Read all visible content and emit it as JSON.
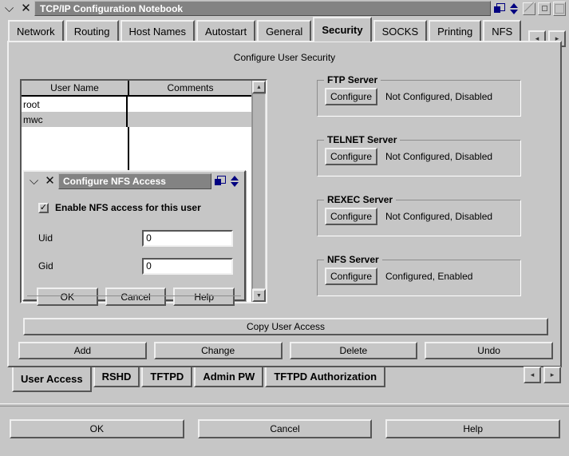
{
  "window": {
    "title": "TCP/IP Configuration Notebook",
    "minimize_icon": "minimize-icon",
    "close_icon": "close-icon",
    "restore_icon": "restore-windows-icon",
    "updown_icon": "up-down-arrows-icon",
    "maximize_icon": "maximize-icon",
    "small_icon": "small-window-icon",
    "frame_icon": "window-frame-icon"
  },
  "top_tabs": {
    "items": [
      {
        "label": "Network",
        "active": false
      },
      {
        "label": "Routing",
        "active": false
      },
      {
        "label": "Host Names",
        "active": false
      },
      {
        "label": "Autostart",
        "active": false
      },
      {
        "label": "General",
        "active": false
      },
      {
        "label": "Security",
        "active": true
      },
      {
        "label": "SOCKS",
        "active": false
      },
      {
        "label": "Printing",
        "active": false
      },
      {
        "label": "NFS",
        "active": false
      }
    ],
    "prev_arrow": "◂",
    "next_arrow": "▸"
  },
  "page": {
    "heading": "Configure User Security"
  },
  "user_list": {
    "columns": [
      "User Name",
      "Comments"
    ],
    "rows": [
      {
        "user_name": "root",
        "comments": "",
        "selected": false
      },
      {
        "user_name": "mwc",
        "comments": "",
        "selected": true
      }
    ],
    "scroll_up": "▲",
    "scroll_down": "▼"
  },
  "servers": [
    {
      "group": "FTP Server",
      "button": "Configure",
      "status": "Not Configured, Disabled"
    },
    {
      "group": "TELNET Server",
      "button": "Configure",
      "status": "Not Configured, Disabled"
    },
    {
      "group": "REXEC Server",
      "button": "Configure",
      "status": "Not Configured, Disabled"
    },
    {
      "group": "NFS Server",
      "button": "Configure",
      "status": "Configured, Enabled"
    }
  ],
  "actions": {
    "copy_user_access": "Copy User Access",
    "add": "Add",
    "change": "Change",
    "delete": "Delete",
    "undo": "Undo"
  },
  "bottom_tabs": {
    "items": [
      {
        "label": "User Access",
        "active": true
      },
      {
        "label": "RSHD",
        "active": false
      },
      {
        "label": "TFTPD",
        "active": false
      },
      {
        "label": "Admin PW",
        "active": false
      },
      {
        "label": "TFTPD Authorization",
        "active": false
      }
    ],
    "prev_arrow": "◂",
    "next_arrow": "▸"
  },
  "footer": {
    "ok": "OK",
    "cancel": "Cancel",
    "help": "Help"
  },
  "nfs_dialog": {
    "title": "Configure NFS Access",
    "minimize_icon": "minimize-icon",
    "close_icon": "close-icon",
    "checkbox_label": "Enable NFS access for this user",
    "checkbox_checked": true,
    "checkbox_glyph": "✓",
    "uid_label": "Uid",
    "uid_value": "0",
    "gid_label": "Gid",
    "gid_value": "0",
    "ok": "OK",
    "cancel": "Cancel",
    "help": "Help"
  },
  "colors": {
    "background": "#c6c6c6",
    "titlebar": "#838383",
    "titlebar_text": "#ffffff",
    "icon_blue": "#000080",
    "field_background": "#ffffff",
    "selection": "#c6c6c6"
  }
}
